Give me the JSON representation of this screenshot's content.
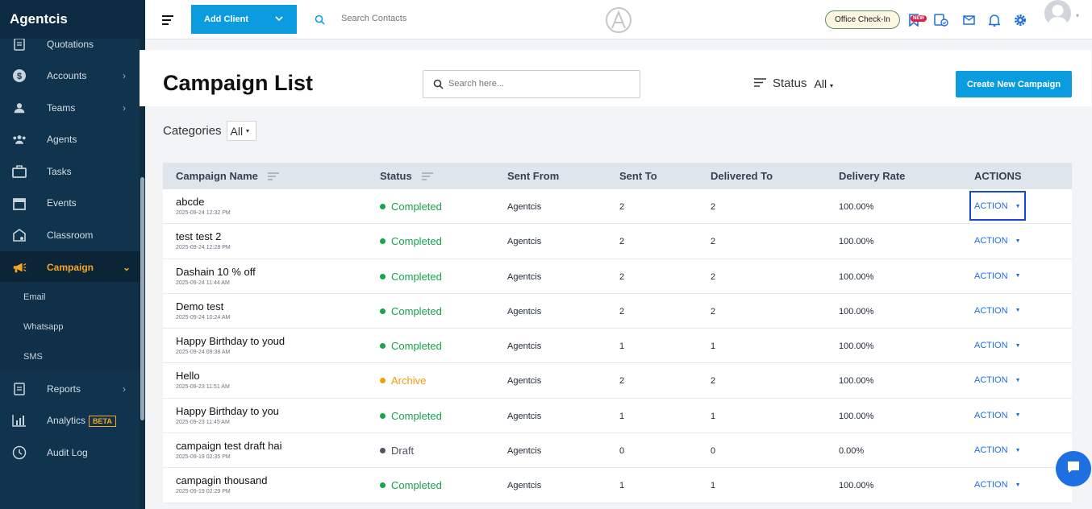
{
  "sidebar": {
    "brand": "Agentcis",
    "items": [
      {
        "label": "Quotations",
        "icon": "document-icon"
      },
      {
        "label": "Accounts",
        "icon": "dollar-icon"
      },
      {
        "label": "Teams",
        "icon": "team-icon"
      },
      {
        "label": "Agents",
        "icon": "agents-icon"
      },
      {
        "label": "Tasks",
        "icon": "briefcase-icon"
      },
      {
        "label": "Events",
        "icon": "calendar-icon"
      },
      {
        "label": "Classroom",
        "icon": "classroom-icon"
      },
      {
        "label": "Campaign",
        "icon": "megaphone-icon"
      },
      {
        "label": "Reports",
        "icon": "report-icon"
      },
      {
        "label": "Analytics",
        "icon": "analytics-icon",
        "badge": "BETA"
      },
      {
        "label": "Audit Log",
        "icon": "audit-icon"
      }
    ],
    "sub_items": [
      "Email",
      "Whatsapp",
      "SMS"
    ],
    "accent_color": "#f5a623"
  },
  "topbar": {
    "add_client_label": "Add Client",
    "search_placeholder": "Search Contacts",
    "office_checkin_label": "Office Check-In",
    "new_badge": "NEW"
  },
  "page": {
    "title": "Campaign List",
    "search_placeholder": "Search here...",
    "status_label": "Status",
    "status_value": "All",
    "create_button": "Create New Campaign",
    "categories_label": "Categories",
    "categories_value": "All"
  },
  "table": {
    "headers": [
      "Campaign Name",
      "Status",
      "Sent From",
      "Sent To",
      "Delivered To",
      "Delivery Rate",
      "ACTIONS"
    ],
    "rows": [
      {
        "name": "abcde",
        "date": "2025-09-24 12:32 PM",
        "status": "Completed",
        "from": "Agentcis",
        "sent": "2",
        "delivered": "2",
        "rate": "100.00%",
        "action": "ACTION"
      },
      {
        "name": "test test 2",
        "date": "2025-09-24 12:28 PM",
        "status": "Completed",
        "from": "Agentcis",
        "sent": "2",
        "delivered": "2",
        "rate": "100.00%",
        "action": "ACTION"
      },
      {
        "name": "Dashain 10 % off",
        "date": "2025-09-24 11:44 AM",
        "status": "Completed",
        "from": "Agentcis",
        "sent": "2",
        "delivered": "2",
        "rate": "100.00%",
        "action": "ACTION"
      },
      {
        "name": "Demo test",
        "date": "2025-09-24 10:24 AM",
        "status": "Completed",
        "from": "Agentcis",
        "sent": "2",
        "delivered": "2",
        "rate": "100.00%",
        "action": "ACTION"
      },
      {
        "name": "Happy Birthday to youd",
        "date": "2025-09-24 09:38 AM",
        "status": "Completed",
        "from": "Agentcis",
        "sent": "1",
        "delivered": "1",
        "rate": "100.00%",
        "action": "ACTION"
      },
      {
        "name": "Hello",
        "date": "2025-09-23 11:51 AM",
        "status": "Archive",
        "from": "Agentcis",
        "sent": "2",
        "delivered": "2",
        "rate": "100.00%",
        "action": "ACTION"
      },
      {
        "name": "Happy Birthday to you",
        "date": "2025-09-23 11:45 AM",
        "status": "Completed",
        "from": "Agentcis",
        "sent": "1",
        "delivered": "1",
        "rate": "100.00%",
        "action": "ACTION"
      },
      {
        "name": "campaign test draft hai",
        "date": "2025-09-19 02:35 PM",
        "status": "Draft",
        "from": "Agentcis",
        "sent": "0",
        "delivered": "0",
        "rate": "0.00%",
        "action": "ACTION"
      },
      {
        "name": "campagin thousand",
        "date": "2025-09-19 02:29 PM",
        "status": "Completed",
        "from": "Agentcis",
        "sent": "1",
        "delivered": "1",
        "rate": "100.00%",
        "action": "ACTION"
      }
    ]
  },
  "status_colors": {
    "Completed": "#16a34a",
    "Archive": "#f59e0b",
    "Draft": "#4b5563"
  }
}
